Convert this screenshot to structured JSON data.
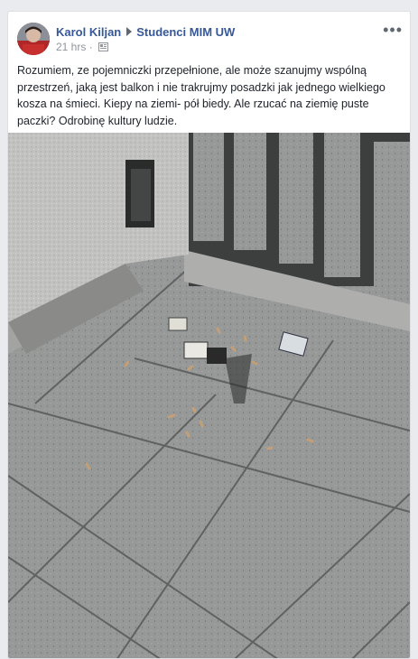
{
  "post": {
    "author": "Karol Kiljan",
    "group": "Studenci MIM UW",
    "time": "21 hrs",
    "audience_icon": "group-icon",
    "more_icon": "more-options-icon",
    "text": "Rozumiem, ze pojemniczki przepełnione, ale może szanujmy wspólną przestrzeń, jaką jest balkon i nie trakrujmy posadzki jak jednego wielkiego kosza na śmieci. Kiepy na ziemi- pół biedy. Ale rzucać na ziemię puste paczki? Odrobinę kultury ludzie.",
    "more_label": "•••"
  },
  "colors": {
    "link": "#365899",
    "text": "#1d2129",
    "meta": "#90949c",
    "background": "#e9ebee"
  }
}
